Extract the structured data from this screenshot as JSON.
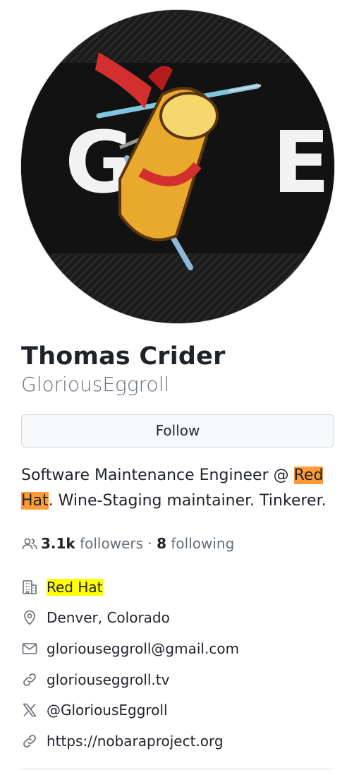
{
  "profile": {
    "name": "Thomas Crider",
    "login": "GloriousEggroll",
    "avatar_letters": [
      "G",
      "E"
    ],
    "follow_label": "Follow",
    "bio": {
      "before": "Software Maintenance Engineer @ ",
      "org": "Red Hat",
      "after": ". Wine-Staging maintainer. Tinkerer."
    },
    "stats": {
      "followers_count": "3.1k",
      "followers_label": "followers",
      "separator": "·",
      "following_count": "8",
      "following_label": "following"
    },
    "details": {
      "company": "Red Hat",
      "location": "Denver, Colorado",
      "email": "gloriouseggroll@gmail.com",
      "website": "gloriouseggroll.tv",
      "twitter": "@GloriousEggroll",
      "link": "https://nobaraproject.org"
    }
  },
  "colors": {
    "bio_highlight": "#ff9a36",
    "company_highlight": "#ffff00",
    "muted_text": "#656d76",
    "border": "#d0d7de"
  }
}
